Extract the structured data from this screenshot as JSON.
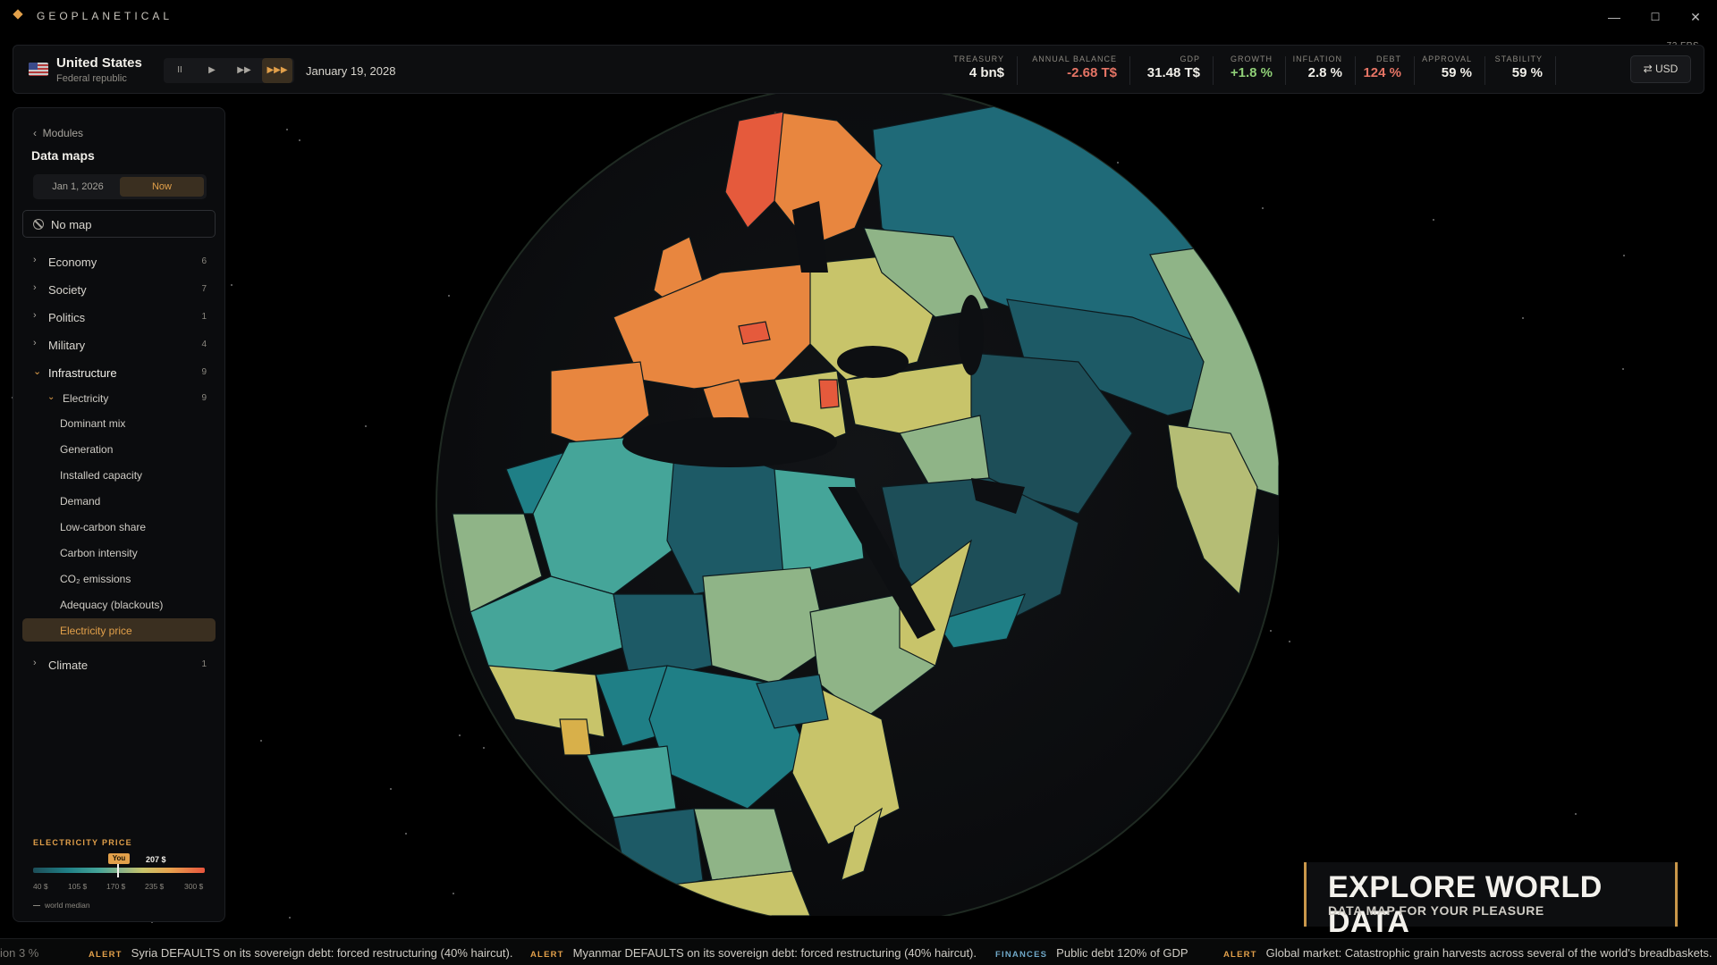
{
  "app": {
    "title": "GEOPLANETICAL",
    "fps": "72 FPS"
  },
  "window_controls": {
    "minimize": "—",
    "maximize": "☐",
    "close": "✕"
  },
  "header": {
    "country": "United States",
    "government": "Federal republic",
    "speed_controls": [
      "II",
      "▶",
      "▶▶",
      "▶▶▶"
    ],
    "active_speed": 3,
    "date": "January 19, 2028",
    "stats": [
      {
        "label": "TREASURY",
        "value": "4 bn$"
      },
      {
        "label": "ANNUAL BALANCE",
        "value": "-2.68 T$"
      },
      {
        "label": "GDP",
        "value": "31.48 T$"
      },
      {
        "label": "GROWTH",
        "value": "+1.8 %"
      },
      {
        "label": "INFLATION",
        "value": "2.8 %"
      },
      {
        "label": "DEBT",
        "value": "124 %"
      },
      {
        "label": "APPROVAL",
        "value": "59 %"
      },
      {
        "label": "STABILITY",
        "value": "59 %"
      }
    ],
    "currency": "⇄ USD"
  },
  "sidebar": {
    "back_label": "Modules",
    "title": "Data maps",
    "date_toggle": [
      "Jan 1, 2026",
      "Now"
    ],
    "no_map_label": "No map",
    "categories": [
      {
        "name": "Economy",
        "count": "6"
      },
      {
        "name": "Society",
        "count": "7"
      },
      {
        "name": "Politics",
        "count": "1"
      },
      {
        "name": "Military",
        "count": "4"
      },
      {
        "name": "Infrastructure",
        "count": "9"
      },
      {
        "name": "Climate",
        "count": "1"
      }
    ],
    "subcategory": {
      "name": "Electricity",
      "count": "9"
    },
    "items": [
      "Dominant mix",
      "Generation",
      "Installed capacity",
      "Demand",
      "Low-carbon share",
      "Carbon intensity",
      "CO₂ emissions",
      "Adequacy (blackouts)",
      "Electricity price"
    ],
    "selected_item": "Electricity price"
  },
  "legend": {
    "title": "ELECTRICITY PRICE",
    "you_label": "You",
    "you_value": "207 $",
    "ticks": [
      "40 $",
      "105 $",
      "170 $",
      "235 $",
      "300 $"
    ],
    "median_label": "world median"
  },
  "colors": {
    "accent": "#e2a04a",
    "scale": [
      "#1d4e58",
      "#1f7f86",
      "#45a599",
      "#8fb487",
      "#c8c46a",
      "#e8a24e",
      "#e8553d"
    ]
  },
  "banner": {
    "headline": "EXPLORE WORLD DATA",
    "subline": "DATA MAP FOR YOUR PLEASURE"
  },
  "ticker": [
    {
      "tag": "",
      "text": "ion 3 %"
    },
    {
      "tag": "ALERT",
      "text": "Syria DEFAULTS on its sovereign debt: forced restructuring (40% haircut)."
    },
    {
      "tag": "ALERT",
      "text": "Myanmar DEFAULTS on its sovereign debt: forced restructuring (40% haircut)."
    },
    {
      "tag": "FINANCES",
      "text": "Public debt 120% of GDP"
    },
    {
      "tag": "ALERT",
      "text": "Global market: Catastrophic grain harvests across several of the world's breadbaskets."
    }
  ]
}
